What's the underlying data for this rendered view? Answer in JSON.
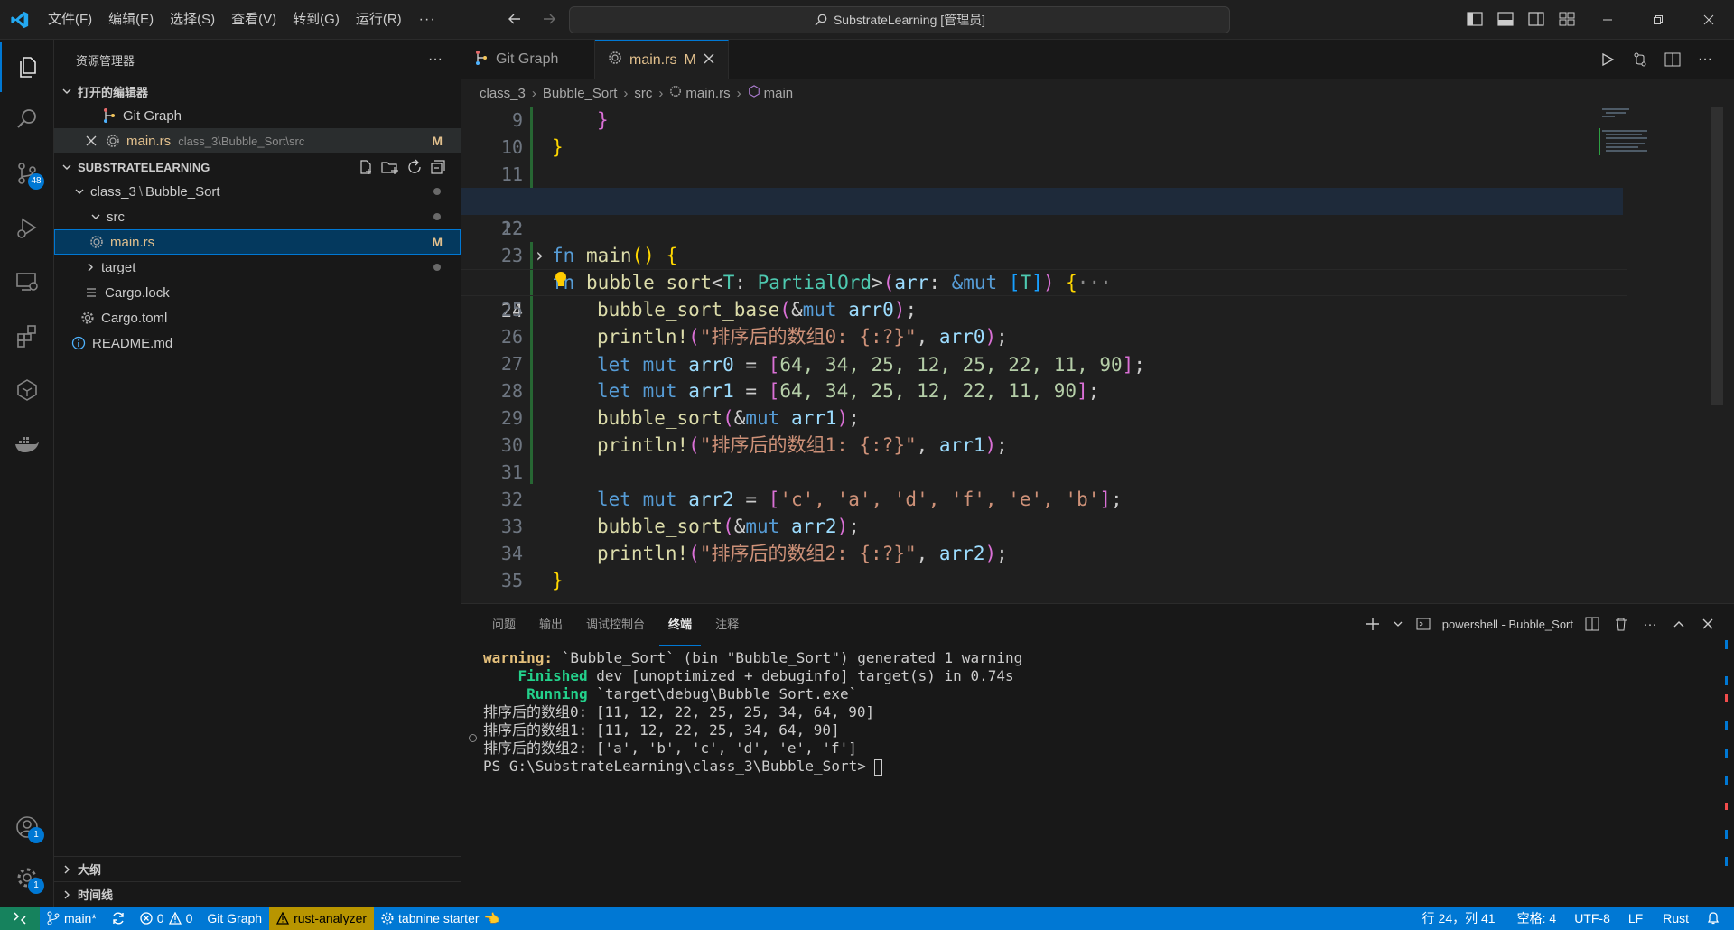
{
  "titlebar": {
    "menu": [
      "文件(F)",
      "编辑(E)",
      "选择(S)",
      "查看(V)",
      "转到(G)",
      "运行(R)"
    ],
    "more": "···",
    "command_center": "SubstrateLearning [管理员]"
  },
  "activity": {
    "scm_badge": "48",
    "accounts_badge": "1",
    "settings_badge": "1"
  },
  "sidebar": {
    "title": "资源管理器",
    "more": "···",
    "open_editors_title": "打开的编辑器",
    "open_editors": [
      {
        "label": "Git Graph"
      },
      {
        "label": "main.rs",
        "path": "class_3\\Bubble_Sort\\src",
        "status": "M"
      }
    ],
    "workspace_title": "SUBSTRATELEARNING",
    "tree": {
      "folder1": "class_3",
      "folder1_sep": "\\",
      "folder1b": "Bubble_Sort",
      "src": "src",
      "main": "main.rs",
      "main_status": "M",
      "target": "target",
      "cargo_lock": "Cargo.lock",
      "cargo_toml": "Cargo.toml",
      "readme": "README.md"
    },
    "outline": "大纲",
    "timeline": "时间线"
  },
  "tabs": [
    {
      "label": "Git Graph"
    },
    {
      "label": "main.rs",
      "status": "M"
    }
  ],
  "breadcrumb": [
    "class_3",
    "Bubble_Sort",
    "src",
    "main.rs",
    "main"
  ],
  "code": {
    "ln9": "9",
    "ln10": "10",
    "ln11": "11",
    "ln12": "12",
    "ln22": "22",
    "ln23": "23",
    "ln24": "24",
    "ln25": "25",
    "ln26": "26",
    "ln27": "27",
    "ln28": "28",
    "ln29": "29",
    "ln30": "30",
    "ln31": "31",
    "ln32": "32",
    "ln33": "33",
    "ln34": "34",
    "ln35": "35",
    "l12_fn": "fn",
    "l12_name": "bubble_sort",
    "l12_T": "T",
    "l12_trait": "PartialOrd",
    "l12_arr": "arr",
    "l12_mut": "&mut",
    "l12_T2": "T",
    "l12_fold": "···",
    "l23_fn": "fn",
    "l23_name": "main",
    "let": "let",
    "mut": "mut",
    "arr0": "arr0",
    "arr1": "arr1",
    "arr2": "arr2",
    "arr0_vals": "64, 34, 25, 12, 25, 22, 11, 90",
    "arr1_vals": "64, 34, 25, 12, 22, 11, 90",
    "arr2_vals": "'c', 'a', 'd', 'f', 'e', 'b'",
    "base_fn": "bubble_sort_base",
    "sort_fn": "bubble_sort",
    "println": "println!",
    "str0": "\"排序后的数组0: {:?}\"",
    "str1": "\"排序后的数组1: {:?}\"",
    "str2": "\"排序后的数组2: {:?}\""
  },
  "panel": {
    "tabs": [
      "问题",
      "输出",
      "调试控制台",
      "终端",
      "注释"
    ],
    "active_tab": "终端",
    "terminal_name": "powershell - Bubble_Sort",
    "lines": {
      "warn_label": "warning:",
      "warn_text": " `Bubble_Sort` (bin \"Bubble_Sort\") generated 1 warning",
      "finished_label": "Finished",
      "finished_text": " dev [unoptimized + debuginfo] target(s) in 0.74s",
      "running_label": "Running",
      "running_text": " `target\\debug\\Bubble_Sort.exe`",
      "out0": "排序后的数组0: [11, 12, 22, 25, 25, 34, 64, 90]",
      "out1": "排序后的数组1: [11, 12, 22, 25, 34, 64, 90]",
      "out2": "排序后的数组2: ['a', 'b', 'c', 'd', 'e', 'f']",
      "prompt": "PS G:\\SubstrateLearning\\class_3\\Bubble_Sort> "
    }
  },
  "statusbar": {
    "branch": "main*",
    "errors": "0",
    "warnings": "0",
    "git_graph": "Git Graph",
    "rust_analyzer": "rust-analyzer",
    "tabnine": "tabnine starter",
    "position": "行 24，列 41",
    "spaces": "空格: 4",
    "encoding": "UTF-8",
    "eol": "LF",
    "language": "Rust"
  },
  "colors": {
    "accent": "#0078d4",
    "modified": "#e2c08d",
    "remote": "#16825d",
    "warning": "#b89500"
  }
}
